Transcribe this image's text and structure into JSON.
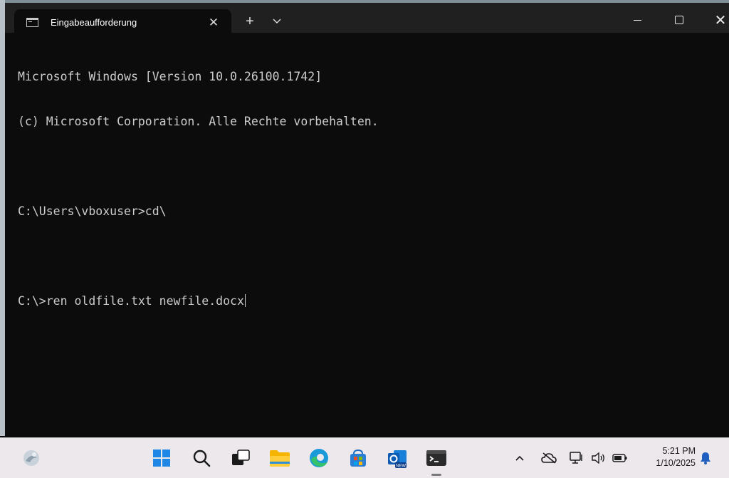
{
  "window": {
    "tab_title": "Eingabeaufforderung",
    "tab_close": "✕",
    "new_tab": "+",
    "dropdown": "⌄",
    "close_glyph": "✕"
  },
  "console": {
    "lines": [
      "Microsoft Windows [Version 10.0.26100.1742]",
      "(c) Microsoft Corporation. Alle Rechte vorbehalten.",
      "",
      "C:\\Users\\vboxuser>cd\\",
      "",
      "C:\\>ren oldfile.txt newfile.docx"
    ]
  },
  "taskbar": {
    "icons": [
      "widgets-icon",
      "start-icon",
      "search-icon",
      "task-view-icon",
      "file-explorer-icon",
      "edge-icon",
      "store-icon",
      "outlook-icon",
      "terminal-icon"
    ],
    "outlook_badge": "NEW",
    "tray": {
      "chevron": "^",
      "icons": [
        "onedrive-icon",
        "network-icon",
        "volume-icon",
        "battery-icon"
      ],
      "time": "5:21 PM",
      "date": "1/10/2025",
      "notification_icon": "bell-icon"
    }
  },
  "colors": {
    "console_bg": "#0c0c0c",
    "console_fg": "#cccccc",
    "titlebar_bg": "#202020",
    "taskbar_bg": "#ece8ec"
  }
}
